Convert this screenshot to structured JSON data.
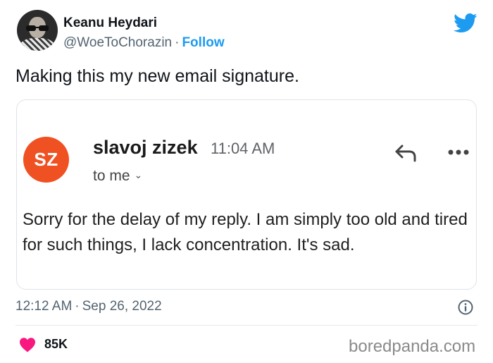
{
  "author": {
    "name": "Keanu Heydari",
    "handle": "@WoeToChorazin",
    "separator": "·",
    "follow_label": "Follow"
  },
  "tweet": {
    "text": "Making this my new email signature.",
    "time": "12:12 AM",
    "separator": "·",
    "date": "Sep 26, 2022",
    "likes": "85K"
  },
  "email": {
    "avatar_initials": "SZ",
    "sender": "slavoj zizek",
    "time": "11:04 AM",
    "recipient": "to me",
    "body": "Sorry for the delay of my reply. I am simply too old and tired for such things, I lack concentration. It's sad."
  },
  "watermark": "boredpanda.com",
  "colors": {
    "twitter_blue": "#1d9bf0",
    "avatar_orange": "#f05123",
    "heart_pink": "#f91880"
  },
  "icons": {
    "brand": "twitter-bird-icon",
    "reply": "reply-arrow-icon",
    "more": "more-dots-icon",
    "info": "info-icon",
    "like": "heart-icon",
    "dropdown": "chevron-down-icon"
  }
}
